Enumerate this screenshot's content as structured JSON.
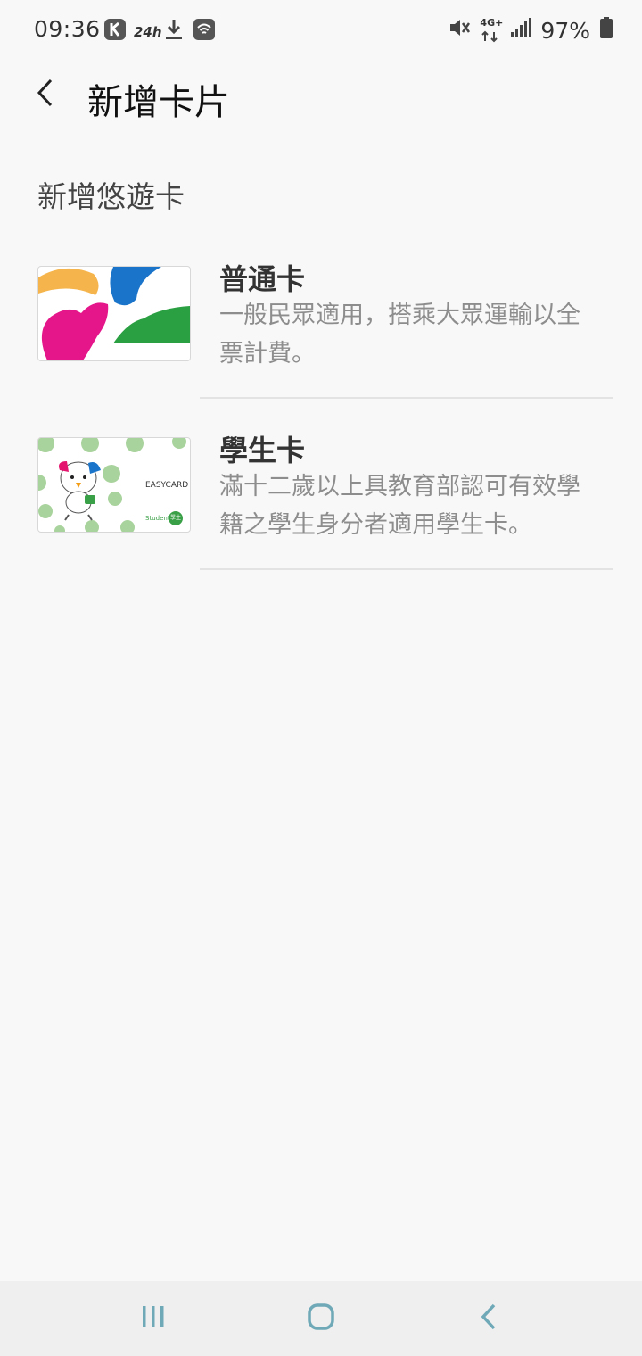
{
  "status_bar": {
    "time": "09:36",
    "badge_24h": "24h",
    "network_label": "4G+",
    "battery": "97%",
    "icons": [
      "k-app-icon",
      "24h-icon",
      "download-icon",
      "wifi-calling-icon",
      "mute-icon",
      "network-4g-icon",
      "signal-icon",
      "battery-icon"
    ]
  },
  "header": {
    "back_icon": "back-chevron-icon",
    "title": "新增卡片"
  },
  "section": {
    "title": "新增悠遊卡"
  },
  "cards": [
    {
      "name": "普通卡",
      "description": "一般民眾適用，搭乘大眾運輸以全票計費。"
    },
    {
      "name": "學生卡",
      "description": "滿十二歲以上具教育部認可有效學籍之學生身分者適用學生卡。",
      "card_logo_text": "EASYCARD",
      "card_student_text": "Student",
      "card_badge_text": "學生"
    }
  ],
  "nav_bar": {
    "icons": [
      "recent-apps-icon",
      "home-icon",
      "back-icon"
    ],
    "color": "#6fa9b8"
  }
}
